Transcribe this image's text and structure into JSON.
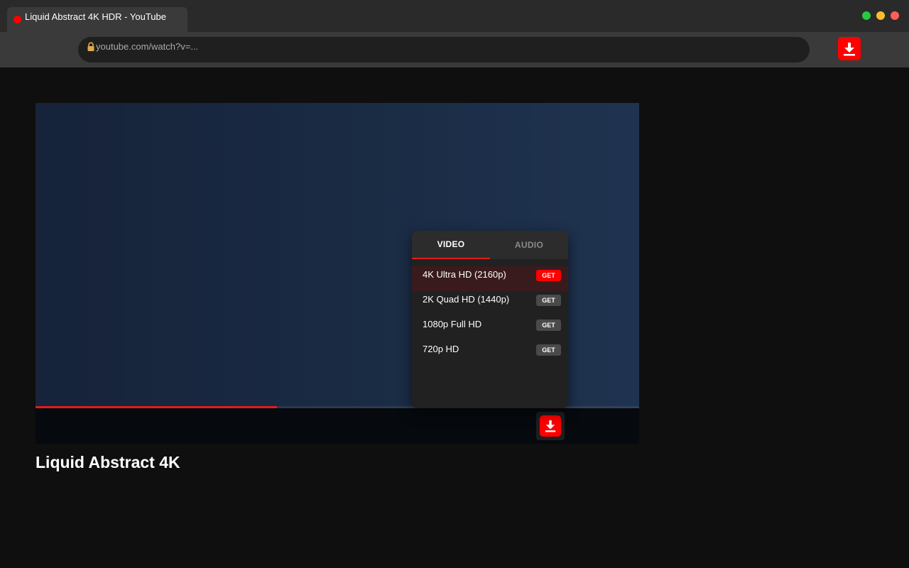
{
  "browser": {
    "tab_title": "Liquid Abstract 4K HDR - YouTube",
    "address": "youtube.com/watch?v=...",
    "window_controls": {
      "green": "#28c840",
      "yellow": "#febc2e",
      "red": "#ff5f57"
    },
    "extension_icon": "download-icon"
  },
  "player": {
    "progress_fraction": 0.4,
    "progress_color": "#e31b1b",
    "download_icon": "download-icon"
  },
  "quality_menu": {
    "tabs": [
      {
        "label": "VIDEO",
        "active": true
      },
      {
        "label": "AUDIO",
        "active": false
      }
    ],
    "options": [
      {
        "label": "4K Ultra HD (2160p)",
        "button": "GET",
        "selected": true
      },
      {
        "label": "2K Quad HD (1440p)",
        "button": "GET",
        "selected": false
      },
      {
        "label": "1080p Full HD",
        "button": "GET",
        "selected": false
      },
      {
        "label": "720p HD",
        "button": "GET",
        "selected": false
      }
    ]
  },
  "video": {
    "title": "Liquid Abstract 4K"
  },
  "colors": {
    "accent": "#ff0000",
    "background": "#0f0f0f"
  }
}
